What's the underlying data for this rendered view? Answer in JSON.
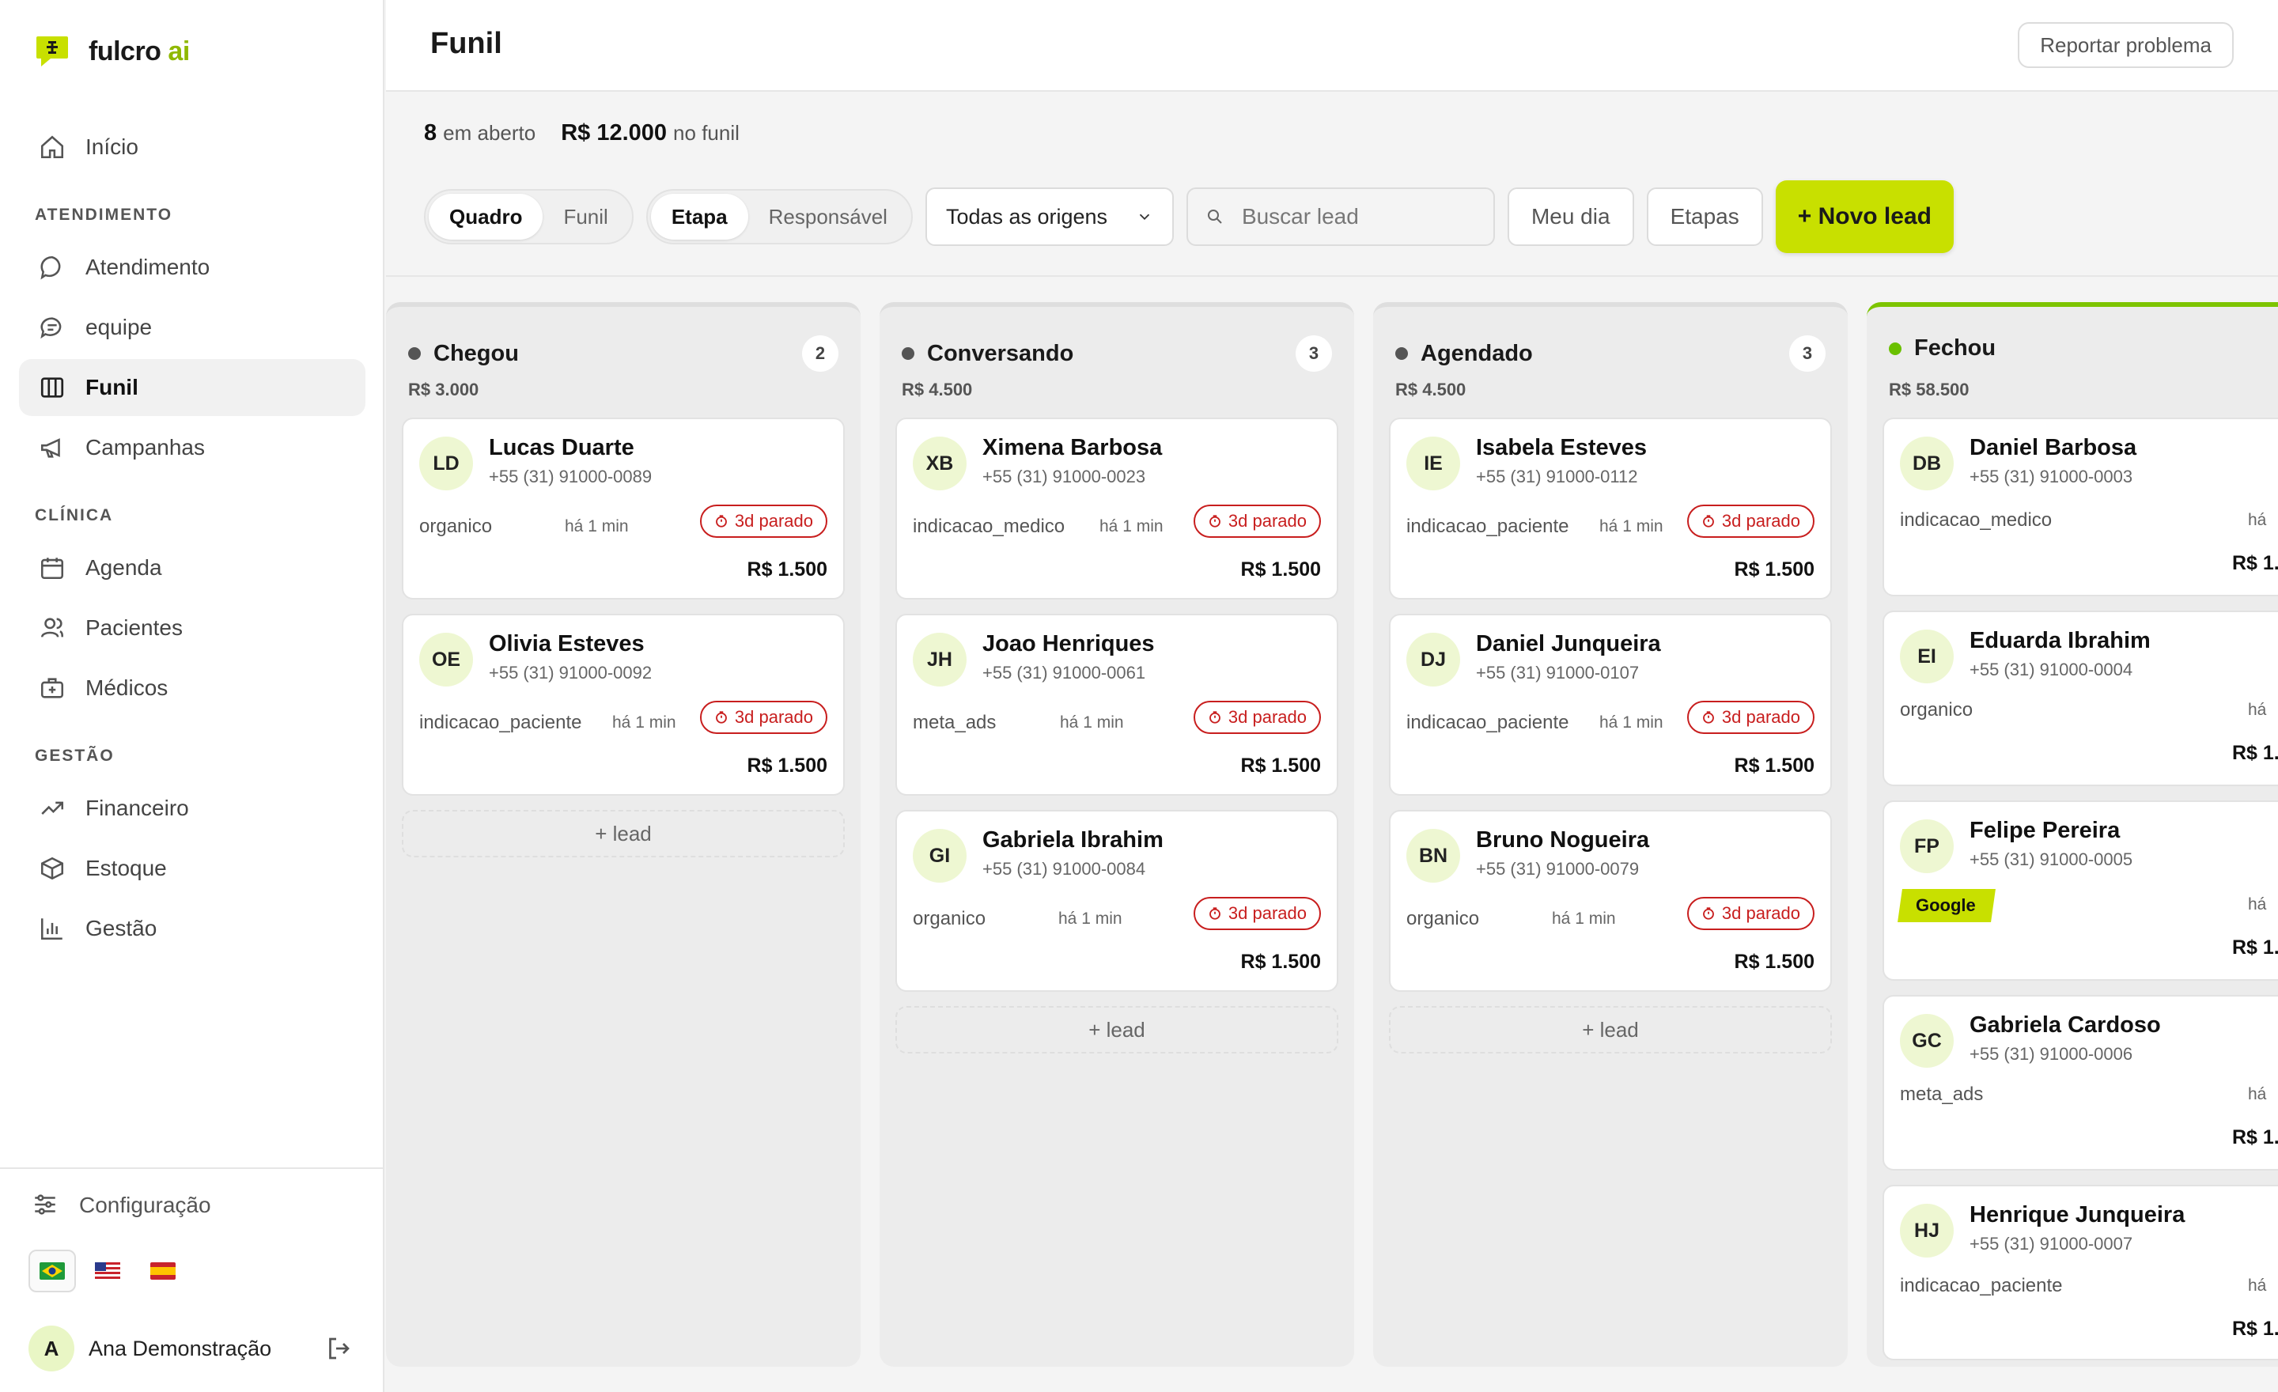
{
  "brand": {
    "name": "fulcro",
    "suffix": "ai",
    "accent": "#c8e000"
  },
  "sidebar": {
    "top_items": [
      {
        "label": "Início",
        "icon": "home-icon"
      }
    ],
    "sections": [
      {
        "title": "ATENDIMENTO",
        "items": [
          {
            "label": "Atendimento",
            "icon": "chat-bubble-icon"
          },
          {
            "label": "equipe",
            "icon": "team-chat-icon"
          },
          {
            "label": "Funil",
            "icon": "kanban-icon",
            "active": true
          },
          {
            "label": "Campanhas",
            "icon": "megaphone-icon"
          }
        ]
      },
      {
        "title": "CLÍNICA",
        "items": [
          {
            "label": "Agenda",
            "icon": "calendar-icon"
          },
          {
            "label": "Pacientes",
            "icon": "users-icon"
          },
          {
            "label": "Médicos",
            "icon": "medical-kit-icon"
          }
        ]
      },
      {
        "title": "GESTÃO",
        "items": [
          {
            "label": "Financeiro",
            "icon": "trending-up-icon"
          },
          {
            "label": "Estoque",
            "icon": "box-icon"
          },
          {
            "label": "Gestão",
            "icon": "bar-chart-icon"
          }
        ]
      }
    ],
    "config_label": "Configuração",
    "languages": [
      "pt-BR",
      "en-US",
      "es-ES"
    ],
    "user": {
      "initial": "A",
      "name": "Ana Demonstração"
    }
  },
  "header": {
    "title": "Funil",
    "report_label": "Reportar problema"
  },
  "summary": {
    "open_count": "8",
    "open_label": "em aberto",
    "funnel_value": "R$ 12.000",
    "funnel_label": "no funil"
  },
  "toolbar": {
    "view_options": [
      "Quadro",
      "Funil"
    ],
    "group_options": [
      "Etapa",
      "Responsável"
    ],
    "origin_select": "Todas as origens",
    "search_placeholder": "Buscar lead",
    "my_day_label": "Meu dia",
    "stages_label": "Etapas",
    "new_lead_label": "+ Novo lead"
  },
  "columns": [
    {
      "title": "Chegou",
      "count": "2",
      "total": "R$ 3.000",
      "add_label": "+ lead",
      "cards": [
        {
          "initials": "LD",
          "name": "Lucas Duarte",
          "phone": "+55 (31) 91000-0089",
          "source": "organico",
          "age": "há 1 min",
          "stale": "3d parado",
          "value": "R$ 1.500"
        },
        {
          "initials": "OE",
          "name": "Olivia Esteves",
          "phone": "+55 (31) 91000-0092",
          "source": "indicacao_paciente",
          "age": "há 1 min",
          "stale": "3d parado",
          "value": "R$ 1.500"
        }
      ]
    },
    {
      "title": "Conversando",
      "count": "3",
      "total": "R$ 4.500",
      "add_label": "+ lead",
      "cards": [
        {
          "initials": "XB",
          "name": "Ximena Barbosa",
          "phone": "+55 (31) 91000-0023",
          "source": "indicacao_medico",
          "age": "há 1 min",
          "stale": "3d parado",
          "value": "R$ 1.500"
        },
        {
          "initials": "JH",
          "name": "Joao Henriques",
          "phone": "+55 (31) 91000-0061",
          "source": "meta_ads",
          "age": "há 1 min",
          "stale": "3d parado",
          "value": "R$ 1.500"
        },
        {
          "initials": "GI",
          "name": "Gabriela Ibrahim",
          "phone": "+55 (31) 91000-0084",
          "source": "organico",
          "age": "há 1 min",
          "stale": "3d parado",
          "value": "R$ 1.500"
        }
      ]
    },
    {
      "title": "Agendado",
      "count": "3",
      "total": "R$ 4.500",
      "add_label": "+ lead",
      "cards": [
        {
          "initials": "IE",
          "name": "Isabela Esteves",
          "phone": "+55 (31) 91000-0112",
          "source": "indicacao_paciente",
          "age": "há 1 min",
          "stale": "3d parado",
          "value": "R$ 1.500"
        },
        {
          "initials": "DJ",
          "name": "Daniel Junqueira",
          "phone": "+55 (31) 91000-0107",
          "source": "indicacao_paciente",
          "age": "há 1 min",
          "stale": "3d parado",
          "value": "R$ 1.500"
        },
        {
          "initials": "BN",
          "name": "Bruno Nogueira",
          "phone": "+55 (31) 91000-0079",
          "source": "organico",
          "age": "há 1 min",
          "stale": "3d parado",
          "value": "R$ 1.500"
        }
      ]
    },
    {
      "title": "Fechou",
      "total": "R$ 58.500",
      "cards": [
        {
          "initials": "DB",
          "name": "Daniel Barbosa",
          "phone": "+55 (31) 91000-0003",
          "source": "indicacao_medico",
          "age": "há",
          "value": "R$ 1."
        },
        {
          "initials": "EI",
          "name": "Eduarda Ibrahim",
          "phone": "+55 (31) 91000-0004",
          "source": "organico",
          "age": "há",
          "value": "R$ 1."
        },
        {
          "initials": "FP",
          "name": "Felipe Pereira",
          "phone": "+55 (31) 91000-0005",
          "tag": "Google",
          "age": "há",
          "value": "R$ 1."
        },
        {
          "initials": "GC",
          "name": "Gabriela Cardoso",
          "phone": "+55 (31) 91000-0006",
          "source": "meta_ads",
          "age": "há",
          "value": "R$ 1."
        },
        {
          "initials": "HJ",
          "name": "Henrique Junqueira",
          "phone": "+55 (31) 91000-0007",
          "source": "indicacao_paciente",
          "age": "há",
          "value": "R$ 1."
        }
      ]
    }
  ]
}
